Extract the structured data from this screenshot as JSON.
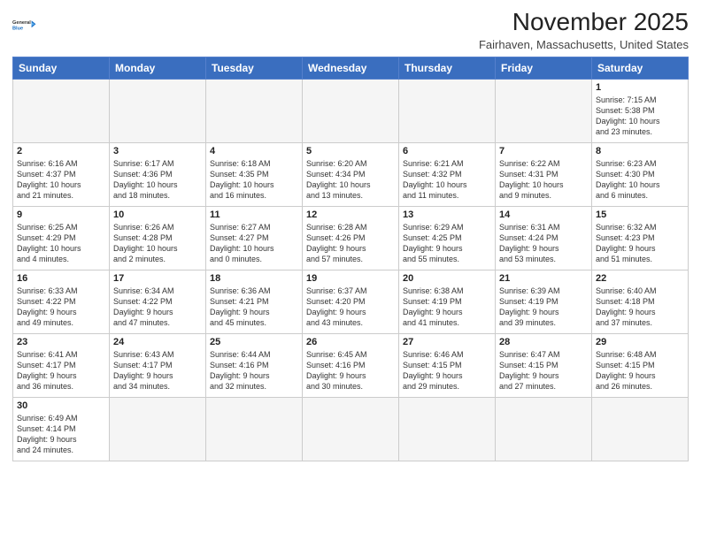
{
  "logo": {
    "line1": "General",
    "line2": "Blue"
  },
  "title": "November 2025",
  "location": "Fairhaven, Massachusetts, United States",
  "headers": [
    "Sunday",
    "Monday",
    "Tuesday",
    "Wednesday",
    "Thursday",
    "Friday",
    "Saturday"
  ],
  "weeks": [
    [
      {
        "day": "",
        "info": "",
        "empty": true
      },
      {
        "day": "",
        "info": "",
        "empty": true
      },
      {
        "day": "",
        "info": "",
        "empty": true
      },
      {
        "day": "",
        "info": "",
        "empty": true
      },
      {
        "day": "",
        "info": "",
        "empty": true
      },
      {
        "day": "",
        "info": "",
        "empty": true
      },
      {
        "day": "1",
        "info": "Sunrise: 7:15 AM\nSunset: 5:38 PM\nDaylight: 10 hours\nand 23 minutes."
      }
    ],
    [
      {
        "day": "2",
        "info": "Sunrise: 6:16 AM\nSunset: 4:37 PM\nDaylight: 10 hours\nand 21 minutes."
      },
      {
        "day": "3",
        "info": "Sunrise: 6:17 AM\nSunset: 4:36 PM\nDaylight: 10 hours\nand 18 minutes."
      },
      {
        "day": "4",
        "info": "Sunrise: 6:18 AM\nSunset: 4:35 PM\nDaylight: 10 hours\nand 16 minutes."
      },
      {
        "day": "5",
        "info": "Sunrise: 6:20 AM\nSunset: 4:34 PM\nDaylight: 10 hours\nand 13 minutes."
      },
      {
        "day": "6",
        "info": "Sunrise: 6:21 AM\nSunset: 4:32 PM\nDaylight: 10 hours\nand 11 minutes."
      },
      {
        "day": "7",
        "info": "Sunrise: 6:22 AM\nSunset: 4:31 PM\nDaylight: 10 hours\nand 9 minutes."
      },
      {
        "day": "8",
        "info": "Sunrise: 6:23 AM\nSunset: 4:30 PM\nDaylight: 10 hours\nand 6 minutes."
      }
    ],
    [
      {
        "day": "9",
        "info": "Sunrise: 6:25 AM\nSunset: 4:29 PM\nDaylight: 10 hours\nand 4 minutes."
      },
      {
        "day": "10",
        "info": "Sunrise: 6:26 AM\nSunset: 4:28 PM\nDaylight: 10 hours\nand 2 minutes."
      },
      {
        "day": "11",
        "info": "Sunrise: 6:27 AM\nSunset: 4:27 PM\nDaylight: 10 hours\nand 0 minutes."
      },
      {
        "day": "12",
        "info": "Sunrise: 6:28 AM\nSunset: 4:26 PM\nDaylight: 9 hours\nand 57 minutes."
      },
      {
        "day": "13",
        "info": "Sunrise: 6:29 AM\nSunset: 4:25 PM\nDaylight: 9 hours\nand 55 minutes."
      },
      {
        "day": "14",
        "info": "Sunrise: 6:31 AM\nSunset: 4:24 PM\nDaylight: 9 hours\nand 53 minutes."
      },
      {
        "day": "15",
        "info": "Sunrise: 6:32 AM\nSunset: 4:23 PM\nDaylight: 9 hours\nand 51 minutes."
      }
    ],
    [
      {
        "day": "16",
        "info": "Sunrise: 6:33 AM\nSunset: 4:22 PM\nDaylight: 9 hours\nand 49 minutes."
      },
      {
        "day": "17",
        "info": "Sunrise: 6:34 AM\nSunset: 4:22 PM\nDaylight: 9 hours\nand 47 minutes."
      },
      {
        "day": "18",
        "info": "Sunrise: 6:36 AM\nSunset: 4:21 PM\nDaylight: 9 hours\nand 45 minutes."
      },
      {
        "day": "19",
        "info": "Sunrise: 6:37 AM\nSunset: 4:20 PM\nDaylight: 9 hours\nand 43 minutes."
      },
      {
        "day": "20",
        "info": "Sunrise: 6:38 AM\nSunset: 4:19 PM\nDaylight: 9 hours\nand 41 minutes."
      },
      {
        "day": "21",
        "info": "Sunrise: 6:39 AM\nSunset: 4:19 PM\nDaylight: 9 hours\nand 39 minutes."
      },
      {
        "day": "22",
        "info": "Sunrise: 6:40 AM\nSunset: 4:18 PM\nDaylight: 9 hours\nand 37 minutes."
      }
    ],
    [
      {
        "day": "23",
        "info": "Sunrise: 6:41 AM\nSunset: 4:17 PM\nDaylight: 9 hours\nand 36 minutes."
      },
      {
        "day": "24",
        "info": "Sunrise: 6:43 AM\nSunset: 4:17 PM\nDaylight: 9 hours\nand 34 minutes."
      },
      {
        "day": "25",
        "info": "Sunrise: 6:44 AM\nSunset: 4:16 PM\nDaylight: 9 hours\nand 32 minutes."
      },
      {
        "day": "26",
        "info": "Sunrise: 6:45 AM\nSunset: 4:16 PM\nDaylight: 9 hours\nand 30 minutes."
      },
      {
        "day": "27",
        "info": "Sunrise: 6:46 AM\nSunset: 4:15 PM\nDaylight: 9 hours\nand 29 minutes."
      },
      {
        "day": "28",
        "info": "Sunrise: 6:47 AM\nSunset: 4:15 PM\nDaylight: 9 hours\nand 27 minutes."
      },
      {
        "day": "29",
        "info": "Sunrise: 6:48 AM\nSunset: 4:15 PM\nDaylight: 9 hours\nand 26 minutes."
      }
    ],
    [
      {
        "day": "30",
        "info": "Sunrise: 6:49 AM\nSunset: 4:14 PM\nDaylight: 9 hours\nand 24 minutes.",
        "lastrow": true
      },
      {
        "day": "",
        "info": "",
        "empty": true,
        "lastrow": true
      },
      {
        "day": "",
        "info": "",
        "empty": true,
        "lastrow": true
      },
      {
        "day": "",
        "info": "",
        "empty": true,
        "lastrow": true
      },
      {
        "day": "",
        "info": "",
        "empty": true,
        "lastrow": true
      },
      {
        "day": "",
        "info": "",
        "empty": true,
        "lastrow": true
      },
      {
        "day": "",
        "info": "",
        "empty": true,
        "lastrow": true
      }
    ]
  ]
}
